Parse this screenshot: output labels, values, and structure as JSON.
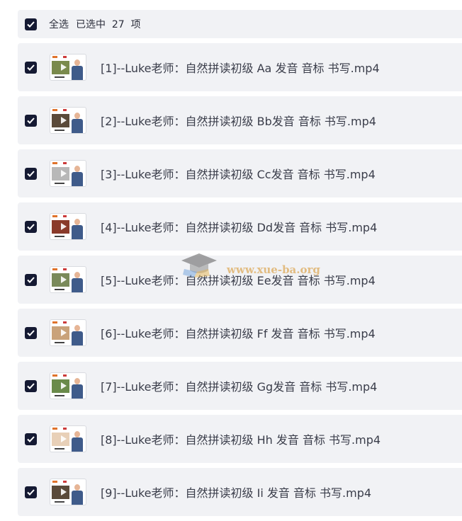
{
  "header": {
    "select_all": "全选",
    "selected_text": "已选中  27  项"
  },
  "files": [
    {
      "name": "[1]--Luke老师：自然拼读初级 Aa 发音 音标 书写.mp4",
      "checked": true,
      "thumb_color": "#7a8a4c"
    },
    {
      "name": "[2]--Luke老师：自然拼读初级 Bb发音 音标 书写.mp4",
      "checked": true,
      "thumb_color": "#5a4a3a"
    },
    {
      "name": "[3]--Luke老师：自然拼读初级 Cc发音 音标 书写.mp4",
      "checked": true,
      "thumb_color": "#b8b8b8"
    },
    {
      "name": "[4]--Luke老师：自然拼读初级 Dd发音 音标 书写.mp4",
      "checked": true,
      "thumb_color": "#8a3a2a"
    },
    {
      "name": "[5]--Luke老师：自然拼读初级 Ee发音 音标 书写.mp4",
      "checked": true,
      "thumb_color": "#7a8a5a"
    },
    {
      "name": "[6]--Luke老师：自然拼读初级 Ff 发音 音标 书写.mp4",
      "checked": true,
      "thumb_color": "#c9a27a"
    },
    {
      "name": "[7]--Luke老师：自然拼读初级 Gg发音 音标 书写.mp4",
      "checked": true,
      "thumb_color": "#6a8a4a"
    },
    {
      "name": "[8]--Luke老师：自然拼读初级 Hh 发音 音标 书写.mp4",
      "checked": true,
      "thumb_color": "#e8d0b8"
    },
    {
      "name": "[9]--Luke老师：自然拼读初级 Ii 发音 音标 书写.mp4",
      "checked": true,
      "thumb_color": "#5a4a3a"
    }
  ],
  "watermark": {
    "text": "www.xue-ba.org"
  },
  "colors": {
    "checkbox": "#151a33",
    "row_bg": "#f1f2f5",
    "text": "#3a3d4a"
  }
}
